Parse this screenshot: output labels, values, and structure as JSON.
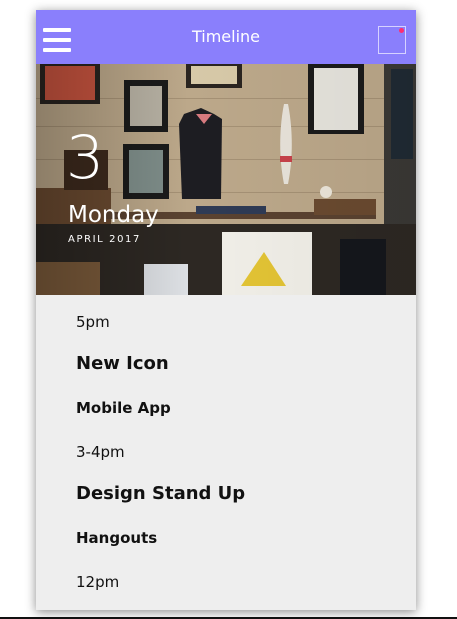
{
  "appbar": {
    "title": "Timeline",
    "menu_icon": "hamburger-menu-icon",
    "notification_icon": "notification-square-icon",
    "accent_color": "#8a7ffc",
    "notification_dot_color": "#ff2d6f"
  },
  "hero": {
    "day_number": "3",
    "day_name": "Monday",
    "month_year": "APRIL 2017"
  },
  "timeline": {
    "entries": [
      {
        "time": "5pm",
        "title": "New Icon",
        "subtitle": "Mobile App"
      },
      {
        "time": "3-4pm",
        "title": "Design Stand Up",
        "subtitle": "Hangouts"
      },
      {
        "time": "12pm"
      }
    ]
  }
}
